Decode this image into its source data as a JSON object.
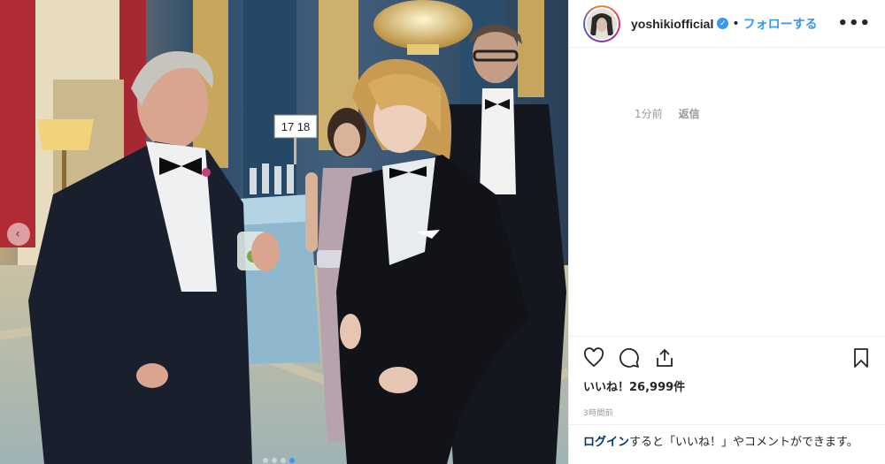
{
  "post": {
    "username": "yoshikiofficial",
    "separator": "•",
    "follow_label": "フォローする",
    "more_icon": "more-options-icon",
    "more_label": "•••"
  },
  "comment": {
    "age": "1分前",
    "reply_label": "返信"
  },
  "photo": {
    "table_sign": "17 18",
    "carousel_pages": 4,
    "carousel_active_index": 3
  },
  "stats": {
    "likes": "いいね！26,999件",
    "posted": "3時間前"
  },
  "login": {
    "link": "ログイン",
    "text": "すると「いいね！」やコメントができます。"
  },
  "colors": {
    "accent": "#3897f0",
    "login_link": "#003569"
  }
}
